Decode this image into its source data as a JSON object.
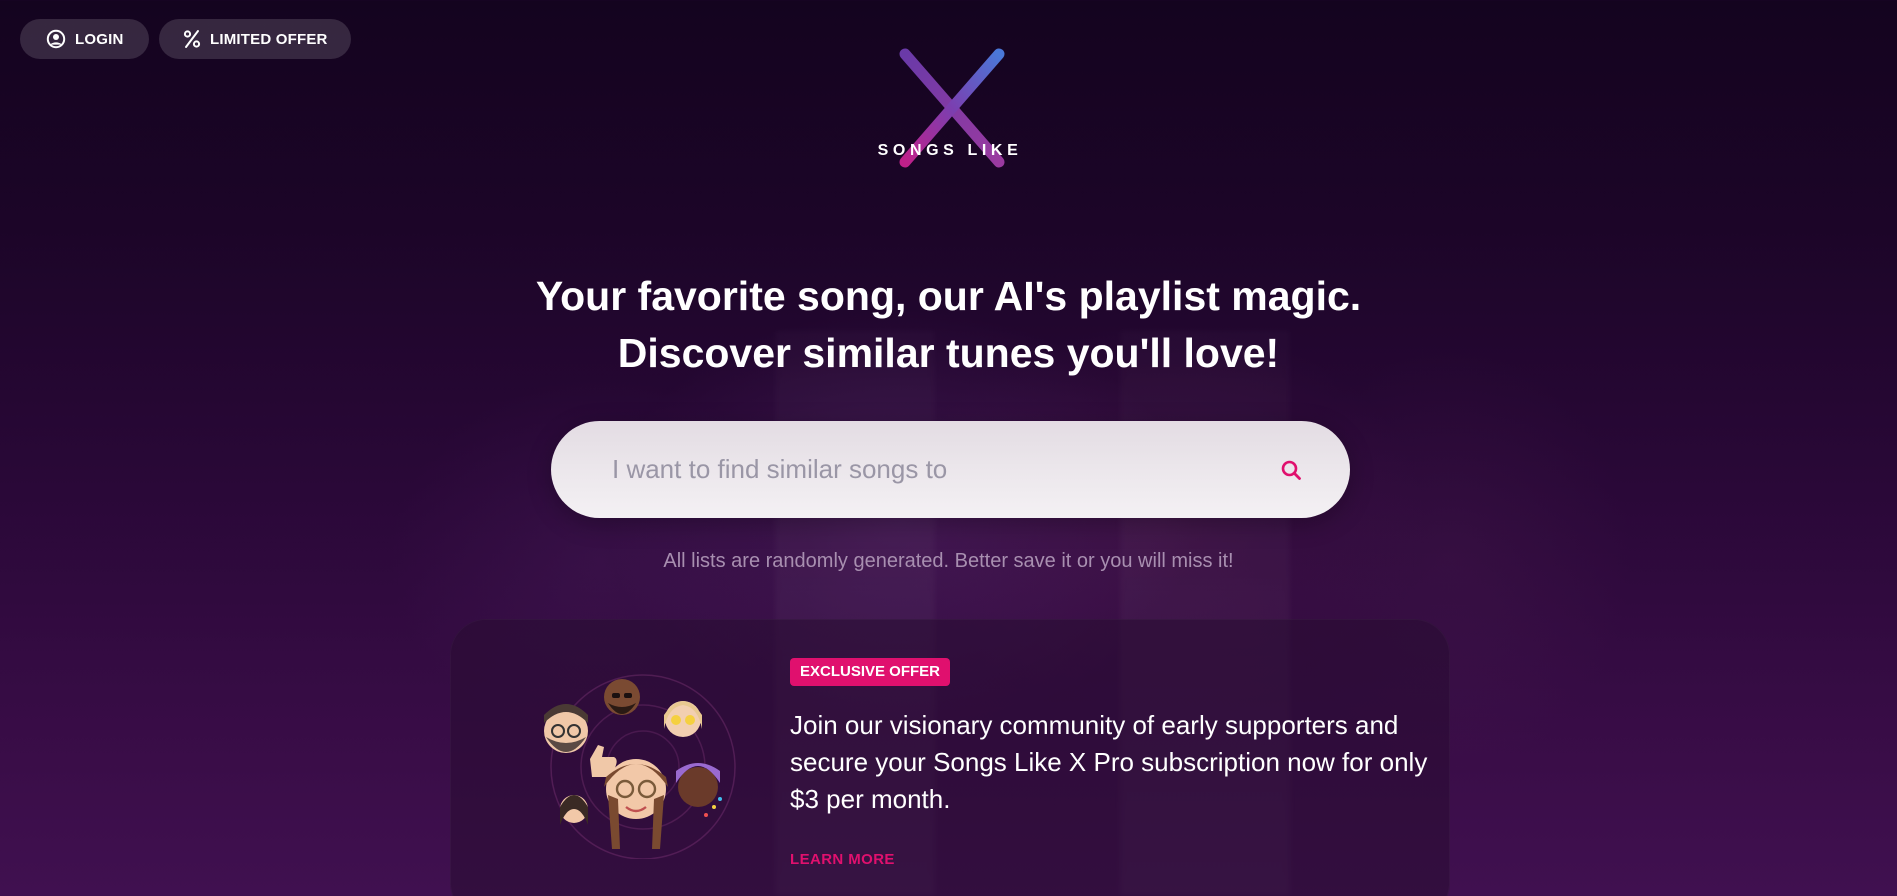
{
  "nav": {
    "login_label": "LOGIN",
    "offer_label": "LIMITED OFFER"
  },
  "logo": {
    "text": "SONGS LIKE",
    "icon": "x-logo-icon"
  },
  "hero": {
    "line1": "Your favorite song, our AI's playlist magic.",
    "line2": "Discover similar tunes you'll love!"
  },
  "search": {
    "placeholder": "I want to find similar songs to",
    "value": "",
    "icon": "search-icon"
  },
  "note": "All lists are randomly generated. Better save it or you will miss it!",
  "offer_card": {
    "badge": "EXCLUSIVE OFFER",
    "description": "Join our visionary community of early supporters and secure your Songs Like X Pro subscription now for only $3 per month.",
    "cta": "LEARN MORE",
    "image": "community-avatars"
  },
  "colors": {
    "accent": "#e0106e",
    "logo_gradient": [
      "#e0106e",
      "#7a3fb0",
      "#3f6fd8"
    ]
  }
}
